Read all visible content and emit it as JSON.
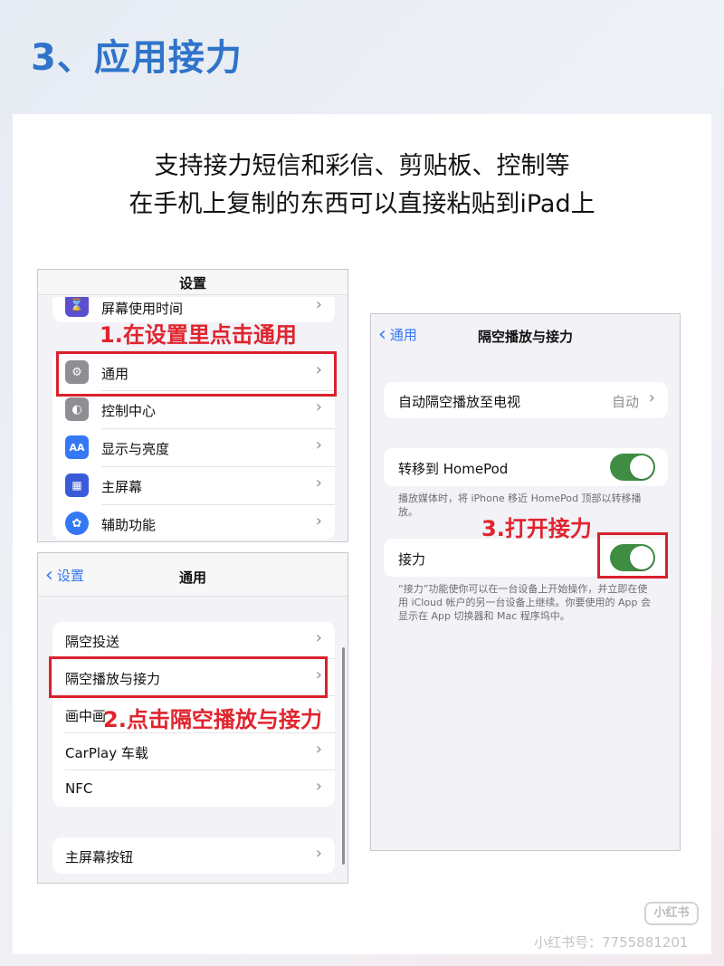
{
  "heading": "3、应用接力",
  "intro": {
    "line1": "支持接力短信和彩信、剪贴板、控制等",
    "line2": "在手机上复制的东西可以直接粘贴到iPad上"
  },
  "settings_screen": {
    "title": "设置",
    "items": [
      {
        "label": "屏幕使用时间",
        "icon": "hourglass-icon",
        "icon_color": "#5a4fcf"
      },
      {
        "label": "通用",
        "icon": "gear-icon",
        "icon_color": "#8e8e93"
      },
      {
        "label": "控制中心",
        "icon": "toggles-icon",
        "icon_color": "#8e8e93"
      },
      {
        "label": "显示与亮度",
        "icon": "text-size-icon",
        "icon_color": "#3478f6"
      },
      {
        "label": "主屏幕",
        "icon": "grid-icon",
        "icon_color": "#3a5bd9"
      },
      {
        "label": "辅助功能",
        "icon": "accessibility-icon",
        "icon_color": "#3478f6"
      }
    ],
    "annotation": "1.在设置里点击通用"
  },
  "general_screen": {
    "back_label": "设置",
    "title": "通用",
    "group1": [
      "隔空投送",
      "隔空播放与接力",
      "画中画",
      "CarPlay 车载",
      "NFC"
    ],
    "group2": [
      "主屏幕按钮"
    ],
    "annotation": "2.点击隔空播放与接力"
  },
  "airplay_screen": {
    "back_label": "通用",
    "title": "隔空播放与接力",
    "auto_airplay_label": "自动隔空播放至电视",
    "auto_airplay_value": "自动",
    "homepod_label": "转移到 HomePod",
    "homepod_enabled": true,
    "homepod_note": "播放媒体时，将 iPhone 移近 HomePod 顶部以转移播放。",
    "handoff_label": "接力",
    "handoff_enabled": true,
    "handoff_note": "“接力”功能使你可以在一台设备上开始操作，并立即在使用 iCloud 帐户的另一台设备上继续。你要使用的 App 会显示在 App 切换器和 Mac 程序坞中。",
    "annotation": "3.打开接力"
  },
  "watermark": {
    "logo": "小红书",
    "id_text": "小红书号：7755881201"
  },
  "colors": {
    "heading": "#2f74c9",
    "annotation_red": "#e0242e",
    "toggle_green": "#3f8d43",
    "ios_blue": "#3478f6"
  }
}
